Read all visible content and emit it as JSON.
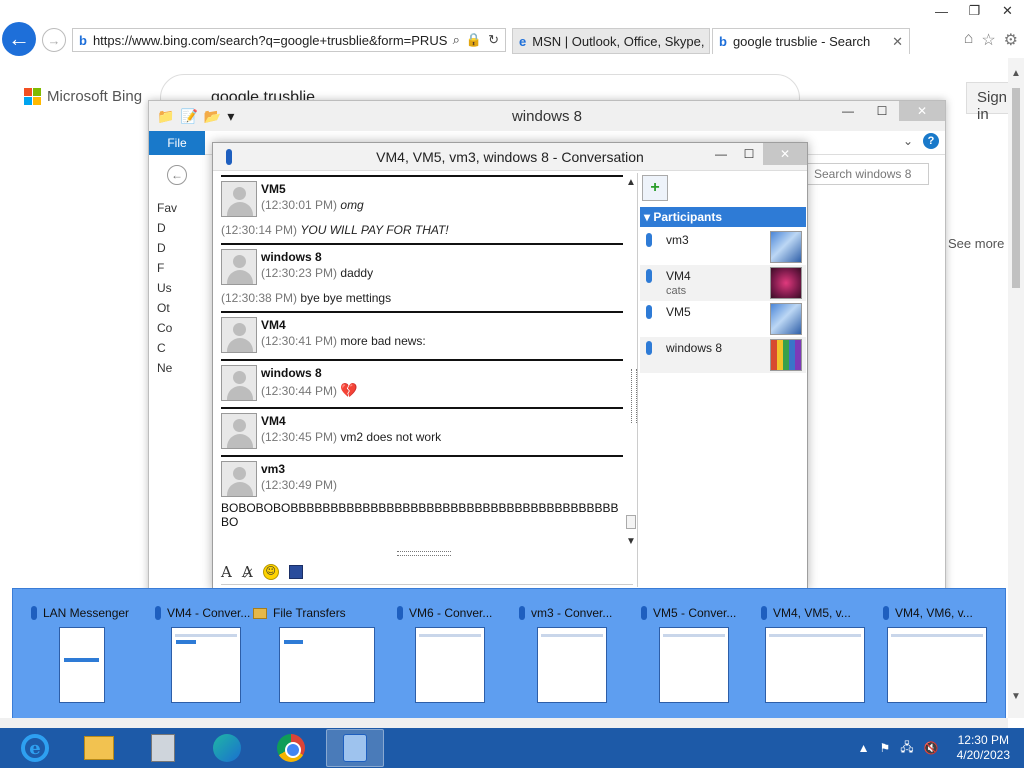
{
  "browser": {
    "address": "https://www.bing.com/search?q=google+trusblie&form=PRUSE",
    "tabs": [
      {
        "title": "MSN | Outlook, Office, Skype, ..."
      },
      {
        "title": "google trusblie - Search"
      }
    ]
  },
  "bing": {
    "brand": "Microsoft Bing",
    "query": "google trusblie",
    "sign_in": "Sign in",
    "see_more": "See more"
  },
  "explorer": {
    "title": "windows 8",
    "file_tab": "File",
    "search_placeholder": "Search windows 8",
    "sidebar": [
      "Fav",
      "D",
      "D",
      "F",
      "Us",
      "Ot",
      "Co",
      "C",
      "Ne"
    ]
  },
  "conversation": {
    "title": "VM4, VM5, vm3, windows 8 - Conversation",
    "messages": [
      {
        "sender": "VM5",
        "lines": [
          {
            "time": "(12:30:01 PM)",
            "text": "omg"
          },
          {
            "time": "(12:30:14 PM)",
            "text": "YOU WILL PAY FOR THAT!"
          }
        ]
      },
      {
        "sender": "windows 8",
        "lines": [
          {
            "time": "(12:30:23 PM)",
            "text": "daddy"
          },
          {
            "time": "(12:30:38 PM)",
            "text": "bye bye mettings"
          }
        ]
      },
      {
        "sender": "VM4",
        "lines": [
          {
            "time": "(12:30:41 PM)",
            "text": "more bad news:"
          }
        ]
      },
      {
        "sender": "windows 8",
        "lines": [
          {
            "time": "(12:30:44 PM)",
            "text": "💔"
          }
        ]
      },
      {
        "sender": "VM4",
        "lines": [
          {
            "time": "(12:30:45 PM)",
            "text": "vm2 does not work"
          }
        ]
      },
      {
        "sender": "vm3",
        "lines": [
          {
            "time": "(12:30:49 PM)",
            "text": ""
          }
        ],
        "body": "BOBOBOBOBBBBBBBBBBBBBBBBBBBBBBBBBBBBBBBBBBBBBBBBBBO"
      }
    ],
    "participants_header": "Participants",
    "participants": [
      {
        "name": "vm3",
        "status": ""
      },
      {
        "name": "VM4",
        "status": "cats"
      },
      {
        "name": "VM5",
        "status": ""
      },
      {
        "name": "windows 8",
        "status": ""
      }
    ]
  },
  "switcher": {
    "items": [
      {
        "label": "LAN Messenger"
      },
      {
        "label": "VM4 - Conver..."
      },
      {
        "label": "File Transfers"
      },
      {
        "label": "VM6 - Conver..."
      },
      {
        "label": "vm3 - Conver..."
      },
      {
        "label": "VM5 - Conver..."
      },
      {
        "label": "VM4, VM5, v..."
      },
      {
        "label": "VM4, VM6, v..."
      }
    ]
  },
  "taskbar": {
    "time": "12:30 PM",
    "date": "4/20/2023"
  }
}
